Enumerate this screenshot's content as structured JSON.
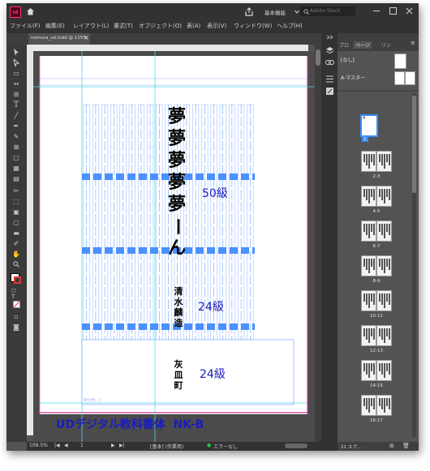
{
  "app": {
    "logo": "Id",
    "home_icon": "home-icon",
    "share_icon": "share-icon",
    "workspace": "基本機能",
    "search_placeholder": "Adobe Stock"
  },
  "menubar": {
    "items": [
      "ファイル(F)",
      "編集(E)",
      "レイアウト(L)",
      "書式(T)",
      "オブジェクト(O)",
      "表(A)",
      "表示(V)",
      "ウィンドウ(W)",
      "ヘルプ(H)"
    ]
  },
  "document_tab": {
    "title": "nomura_ud.indd @ 115%",
    "close": "×"
  },
  "page": {
    "vertical_lines": {
      "big": [
        "夢",
        "夢",
        "夢",
        "夢",
        "夢",
        "ー",
        "ん"
      ],
      "person": [
        "清",
        "水",
        "麟",
        "造"
      ],
      "place": [
        "灰",
        "皿",
        "町"
      ]
    },
    "labels": {
      "size50": "50級",
      "size24a": "24級",
      "size24b": "24級"
    },
    "frame_note": "W×H(...)",
    "font_name": "UDデジタル教科書体  NK-B"
  },
  "status": {
    "zoom": "109.5%",
    "page_number": "1",
    "profile": "[基本] (作業用)",
    "preflight": "エラーなし"
  },
  "pages_panel": {
    "tab_pages": "ページ",
    "tab_prefix": "プロ",
    "tab_other": "リン",
    "none_label": "[なし]",
    "master_label": "A-マスター",
    "first_badge": "A",
    "first_page_label": "1",
    "spreads": [
      "2-3",
      "4-5",
      "6-7",
      "8-9",
      "10-11",
      "12-13",
      "14-15",
      "16-17"
    ],
    "footer": "21 スプ..."
  },
  "colors": {
    "guide_blue": "#4a90ff",
    "guide_cyan": "#4dd7e0",
    "text_purple": "#1b1bbf",
    "page_bg": "#ffffff",
    "accent_green": "#36c24a"
  },
  "icons": [
    "home-icon",
    "share-icon",
    "search-icon",
    "chevron-down-icon",
    "layers-icon",
    "link-icon",
    "page-icon",
    "pages-icon",
    "collapse-icon"
  ]
}
